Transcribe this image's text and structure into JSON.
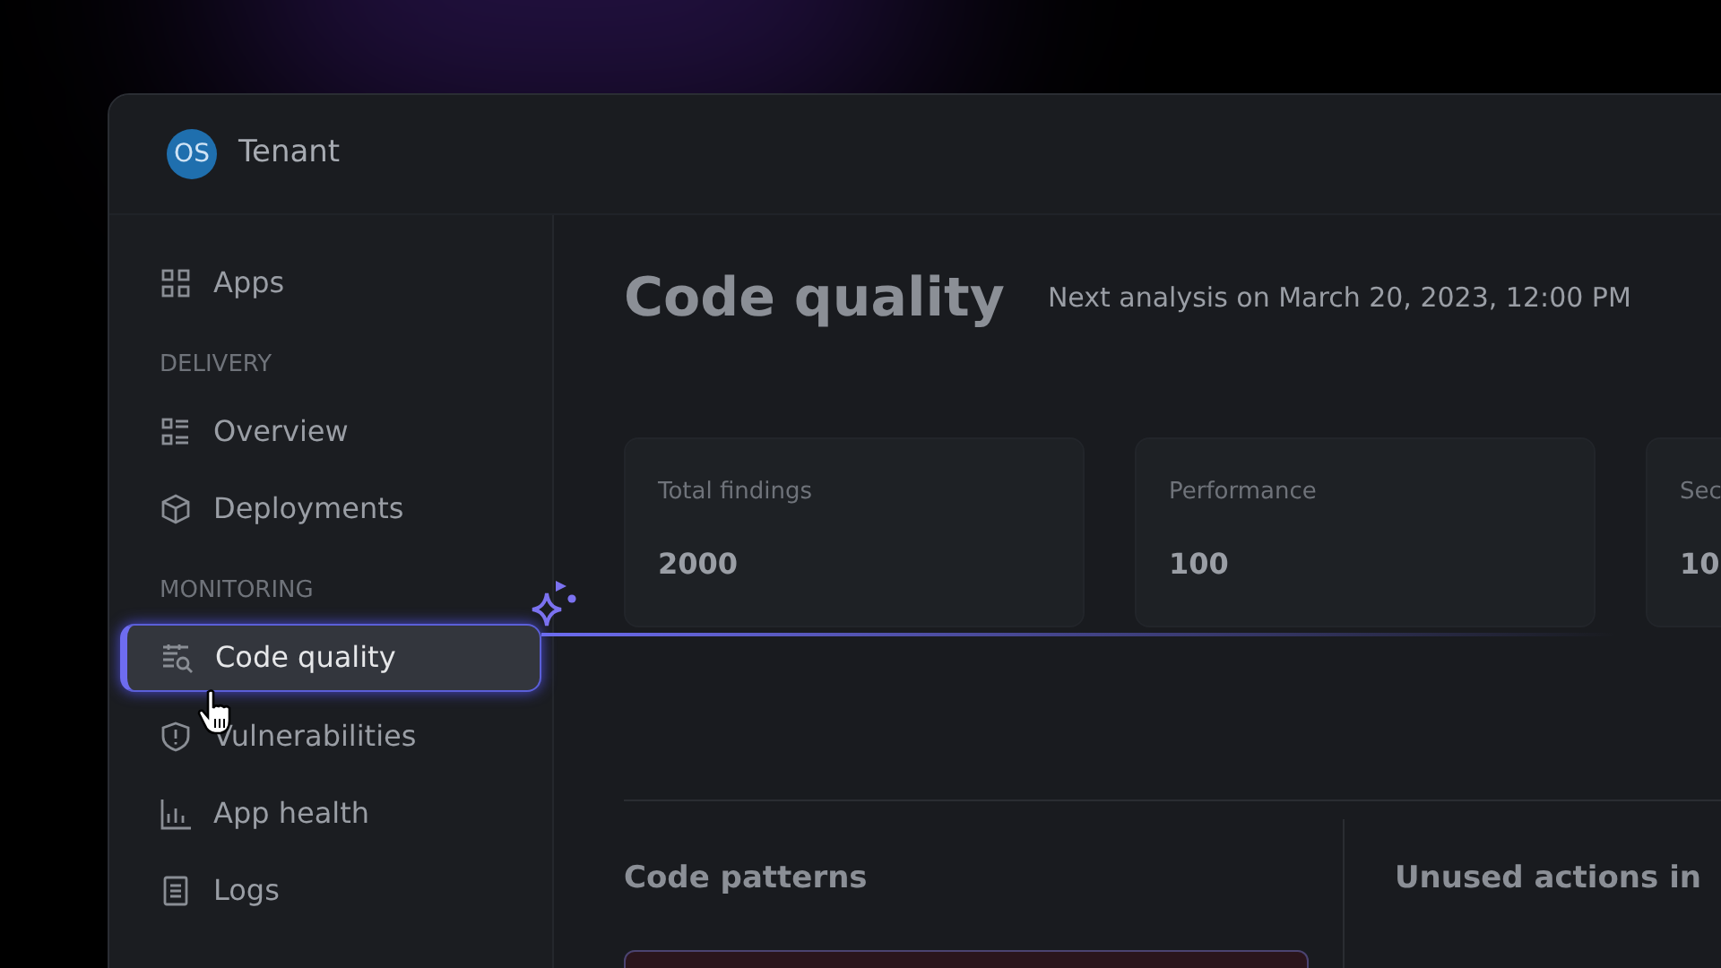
{
  "header": {
    "avatar": "OS",
    "tenant": "Tenant"
  },
  "sidebar": {
    "items": [
      {
        "kind": "item",
        "label": "Apps",
        "selected": false
      },
      {
        "kind": "section",
        "label": "DELIVERY"
      },
      {
        "kind": "item",
        "label": "Overview",
        "selected": false
      },
      {
        "kind": "item",
        "label": "Deployments",
        "selected": false
      },
      {
        "kind": "section",
        "label": "MONITORING"
      },
      {
        "kind": "item",
        "label": "Code quality",
        "selected": true
      },
      {
        "kind": "item",
        "label": "Vulnerabilities",
        "selected": false
      },
      {
        "kind": "item",
        "label": "App health",
        "selected": false
      },
      {
        "kind": "item",
        "label": "Logs",
        "selected": false
      }
    ]
  },
  "page": {
    "title": "Code quality",
    "subtitle": "Next analysis on March 20, 2023, 12:00 PM",
    "cards": [
      {
        "label": "Total findings",
        "value": "2000"
      },
      {
        "label": "Performance",
        "value": "100"
      },
      {
        "label": "Sec",
        "value": "10"
      }
    ],
    "sections": [
      "Code patterns",
      "Unused actions in"
    ]
  }
}
